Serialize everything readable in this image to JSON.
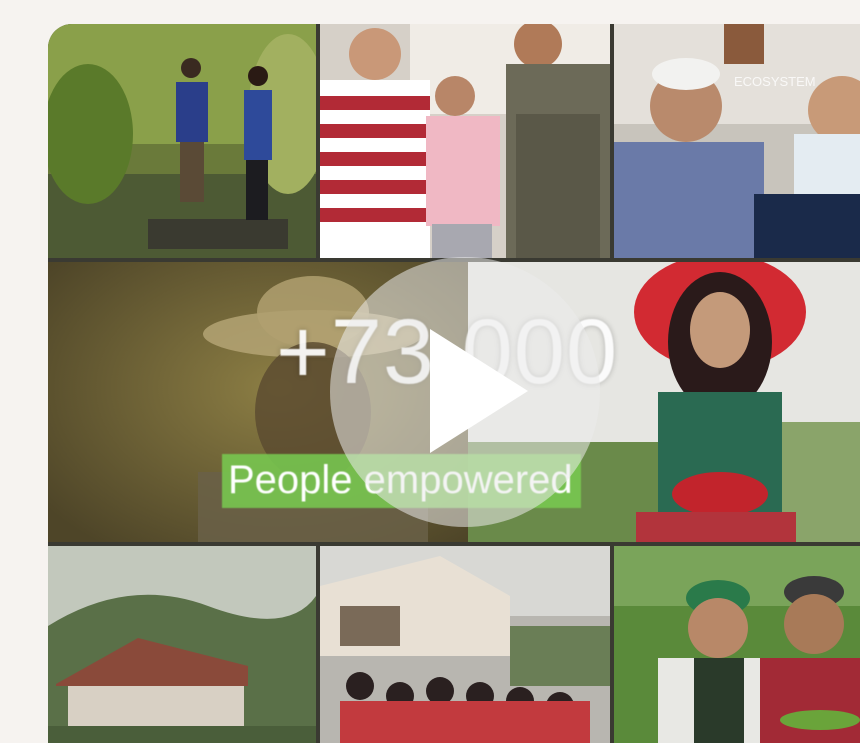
{
  "video": {
    "stat_value": "+73 000",
    "stat_caption": "People empowered",
    "watermark": "ECOSYSTEM",
    "accent_color": "#7bc850",
    "play_icon": "play-icon"
  }
}
